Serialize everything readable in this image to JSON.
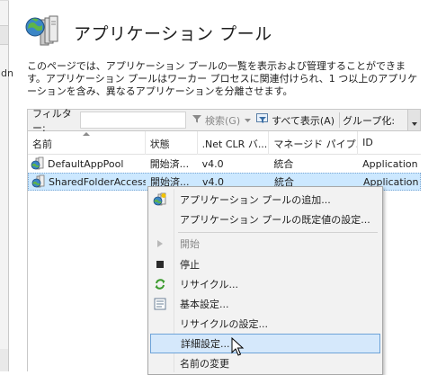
{
  "left_panel": {
    "fragment": "dn"
  },
  "header": {
    "title": "アプリケーション プール",
    "icon": "app-pool-icon"
  },
  "description": "このページでは、アプリケーション プールの一覧を表示および管理することができます。アプリケーション プールはワーカー プロセスに関連付けられ、1 つ以上のアプリケーションを含み、異なるアプリケーションを分離させます。",
  "toolbar": {
    "filter_label": "フィルター:",
    "filter_value": "",
    "search_label": "検索(G)",
    "show_all_label": "すべて表示(A)",
    "group_label": "グループ化:"
  },
  "grid": {
    "columns": [
      "名前",
      "状態",
      ".Net CLR バ...",
      "マネージド パイプ...",
      "ID"
    ],
    "rows": [
      [
        "DefaultAppPool",
        "開始済...",
        "v4.0",
        "統合",
        "Application"
      ],
      [
        "SharedFolderAccess",
        "開始済...",
        "v4.0",
        "統合",
        "Application"
      ]
    ],
    "selected_row": 1
  },
  "context_menu": {
    "items": [
      {
        "label": "アプリケーション プールの追加...",
        "icon": "add-pool-icon",
        "enabled": true
      },
      {
        "label": "アプリケーション プールの既定値の設定...",
        "icon": "",
        "enabled": true
      },
      {
        "label": "開始",
        "icon": "play-icon",
        "enabled": false
      },
      {
        "label": "停止",
        "icon": "stop-icon",
        "enabled": true
      },
      {
        "label": "リサイクル...",
        "icon": "recycle-icon",
        "enabled": true
      },
      {
        "label": "基本設定...",
        "icon": "basic-settings-icon",
        "enabled": true
      },
      {
        "label": "リサイクルの設定...",
        "icon": "",
        "enabled": true
      },
      {
        "label": "詳細設定...",
        "icon": "",
        "enabled": true,
        "hovered": true
      },
      {
        "label": "名前の変更",
        "icon": "",
        "enabled": true
      }
    ]
  },
  "colors": {
    "selection": "#cce8ff",
    "menu_hover": "#d5e8fb",
    "menu_bg": "#f2f2f2",
    "toolbar_bg": "#f0f0f0"
  }
}
